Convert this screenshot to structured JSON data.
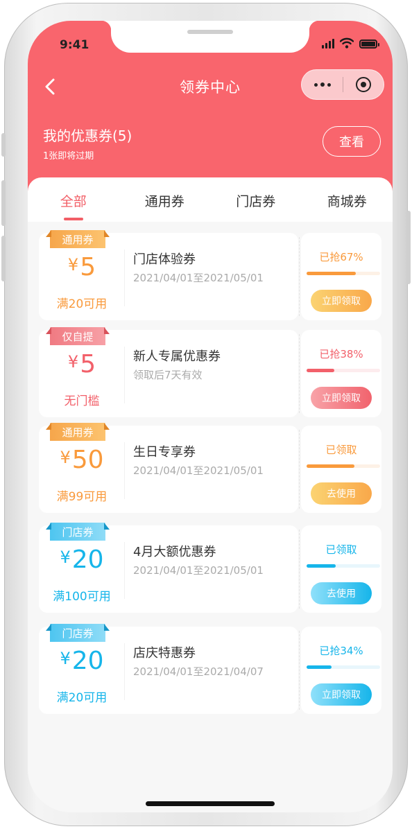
{
  "status_bar": {
    "time": "9:41"
  },
  "nav": {
    "title": "领券中心"
  },
  "summary": {
    "title": "我的优惠券(5)",
    "subtitle": "1张即将过期",
    "view_label": "查看"
  },
  "tabs": [
    {
      "label": "全部",
      "active": true
    },
    {
      "label": "通用券",
      "active": false
    },
    {
      "label": "门店券",
      "active": false
    },
    {
      "label": "商城券",
      "active": false
    }
  ],
  "colors": {
    "header": "#f9656d",
    "orange": "#f99a3c",
    "red": "#f2606a",
    "blue": "#16b5ea"
  },
  "coupons": [
    {
      "tag": "通用券",
      "currency": "¥",
      "amount": "5",
      "condition": "满20可用",
      "name": "门店体验券",
      "validity": "2021/04/01至2021/05/01",
      "status": "已抢67%",
      "progress": 0.67,
      "action": "立即领取",
      "theme": "orange"
    },
    {
      "tag": "仅自提",
      "currency": "¥",
      "amount": "5",
      "condition": "无门槛",
      "name": "新人专属优惠券",
      "validity": "领取后7天有效",
      "status": "已抢38%",
      "progress": 0.38,
      "action": "立即领取",
      "theme": "red"
    },
    {
      "tag": "通用券",
      "currency": "¥",
      "amount": "50",
      "condition": "满99可用",
      "name": "生日专享券",
      "validity": "2021/04/01至2021/05/01",
      "status": "已领取",
      "progress": 0.65,
      "action": "去使用",
      "theme": "orange"
    },
    {
      "tag": "门店券",
      "currency": "¥",
      "amount": "20",
      "condition": "满100可用",
      "name": "4月大额优惠券",
      "validity": "2021/04/01至2021/05/01",
      "status": "已领取",
      "progress": 0.4,
      "action": "去使用",
      "theme": "blue"
    },
    {
      "tag": "门店券",
      "currency": "¥",
      "amount": "20",
      "condition": "满20可用",
      "name": "店庆特惠券",
      "validity": "2021/04/01至2021/04/07",
      "status": "已抢34%",
      "progress": 0.34,
      "action": "立即领取",
      "theme": "blue"
    }
  ]
}
